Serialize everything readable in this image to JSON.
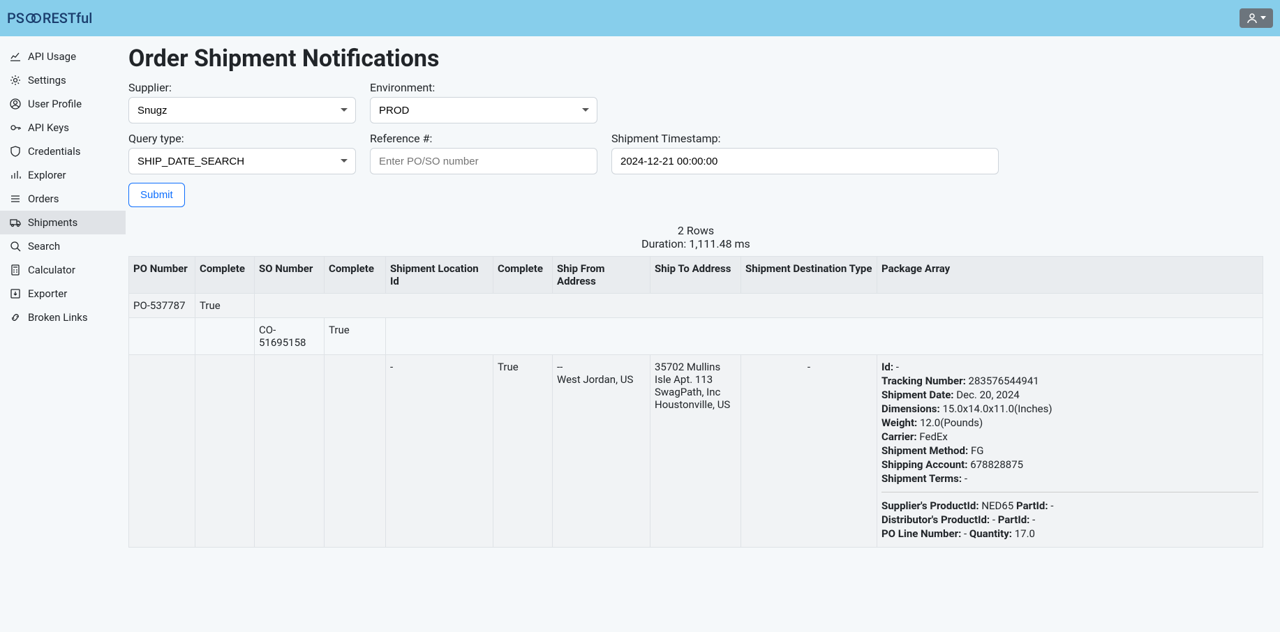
{
  "brand": {
    "ps": "PS",
    "rest": "RESTful"
  },
  "sidebar": {
    "items": [
      {
        "label": "API Usage"
      },
      {
        "label": "Settings"
      },
      {
        "label": "User Profile"
      },
      {
        "label": "API Keys"
      },
      {
        "label": "Credentials"
      },
      {
        "label": "Explorer"
      },
      {
        "label": "Orders"
      },
      {
        "label": "Shipments"
      },
      {
        "label": "Search"
      },
      {
        "label": "Calculator"
      },
      {
        "label": "Exporter"
      },
      {
        "label": "Broken Links"
      }
    ]
  },
  "page": {
    "title": "Order Shipment Notifications",
    "supplier_label": "Supplier:",
    "supplier_value": "Snugz",
    "environment_label": "Environment:",
    "environment_value": "PROD",
    "query_type_label": "Query type:",
    "query_type_value": "SHIP_DATE_SEARCH",
    "reference_label": "Reference #:",
    "reference_placeholder": "Enter PO/SO number",
    "reference_value": "",
    "timestamp_label": "Shipment Timestamp:",
    "timestamp_value": "2024-12-21 00:00:00",
    "submit_label": "Submit"
  },
  "results": {
    "rows_text": "2 Rows",
    "duration_text": "Duration: 1,111.48 ms",
    "headers": {
      "po_number": "PO Number",
      "complete1": "Complete",
      "so_number": "SO Number",
      "complete2": "Complete",
      "shipment_location": "Shipment Location Id",
      "complete3": "Complete",
      "ship_from": "Ship From Address",
      "ship_to": "Ship To Address",
      "dest_type": "Shipment Destination Type",
      "package": "Package Array"
    },
    "row1": {
      "po": "PO-537787",
      "complete": "True"
    },
    "row2": {
      "so": "CO-51695158",
      "complete": "True"
    },
    "row3": {
      "location": "-",
      "complete": "True",
      "from": {
        "l1": "--",
        "l2": "West Jordan, US"
      },
      "to": {
        "l1": "35702 Mullins Isle Apt. 113",
        "l2": "SwagPath, Inc",
        "l3": "Houstonville, US"
      },
      "dest": "-",
      "pkg": {
        "id_label": "Id:",
        "id_val": "-",
        "tracking_label": "Tracking Number:",
        "tracking_val": "283576544941",
        "date_label": "Shipment Date:",
        "date_val": "Dec. 20, 2024",
        "dim_label": "Dimensions:",
        "dim_val": "15.0x14.0x11.0(Inches)",
        "weight_label": "Weight:",
        "weight_val": "12.0(Pounds)",
        "carrier_label": "Carrier:",
        "carrier_val": "FedEx",
        "method_label": "Shipment Method:",
        "method_val": "FG",
        "account_label": "Shipping Account:",
        "account_val": "678828875",
        "terms_label": "Shipment Terms:",
        "terms_val": "-",
        "sup_prod_label": "Supplier's ProductId:",
        "sup_prod_val": "NED65",
        "part1_label": "PartId:",
        "part1_val": "-",
        "dist_prod_label": "Distributor's ProductId:",
        "dist_prod_val": "-",
        "part2_label": "PartId:",
        "part2_val": "-",
        "poline_label": "PO Line Number:",
        "poline_val": "-",
        "qty_label": "Quantity:",
        "qty_val": "17.0"
      }
    }
  }
}
